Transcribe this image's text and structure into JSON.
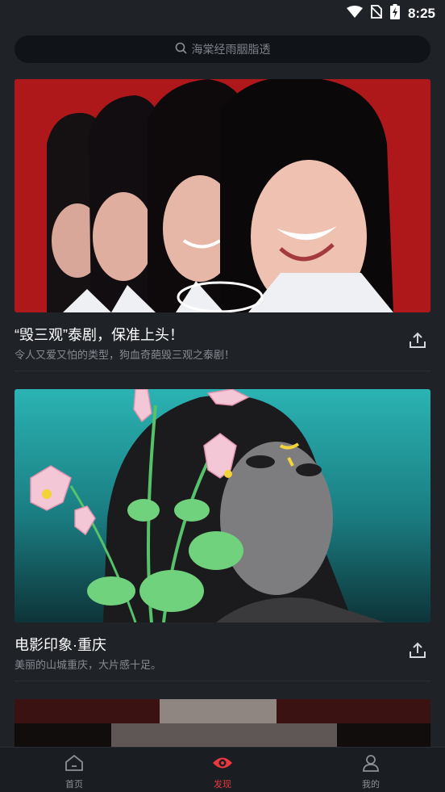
{
  "status_bar": {
    "time": "8:25",
    "icons": [
      "wifi-icon",
      "no-sim-icon",
      "battery-charging-icon"
    ]
  },
  "search": {
    "icon": "search-icon",
    "placeholder": "海棠经雨胭脂透"
  },
  "feed": [
    {
      "title": "“毁三观”泰剧，保准上头！",
      "subtitle": "令人又爱又怕的类型，狗血奇葩毁三观之泰剧！",
      "image": "four-girls-red-background-poster",
      "share_icon": "share-upload-icon"
    },
    {
      "title": "电影印象·重庆",
      "subtitle": "美丽的山城重庆，大片感十足。",
      "image": "face-with-flowers-teal-poster",
      "share_icon": "share-upload-icon"
    },
    {
      "title": "",
      "subtitle": "",
      "image": "dark-horror-face-poster"
    }
  ],
  "bottom_nav": {
    "items": [
      {
        "label": "首页",
        "icon": "home-icon"
      },
      {
        "label": "发现",
        "icon": "eye-icon",
        "active": true
      },
      {
        "label": "我的",
        "icon": "person-icon"
      }
    ]
  },
  "colors": {
    "background": "#1f2227",
    "accent": "#e8393e",
    "text_primary": "#ffffff",
    "text_secondary": "#878b92"
  }
}
